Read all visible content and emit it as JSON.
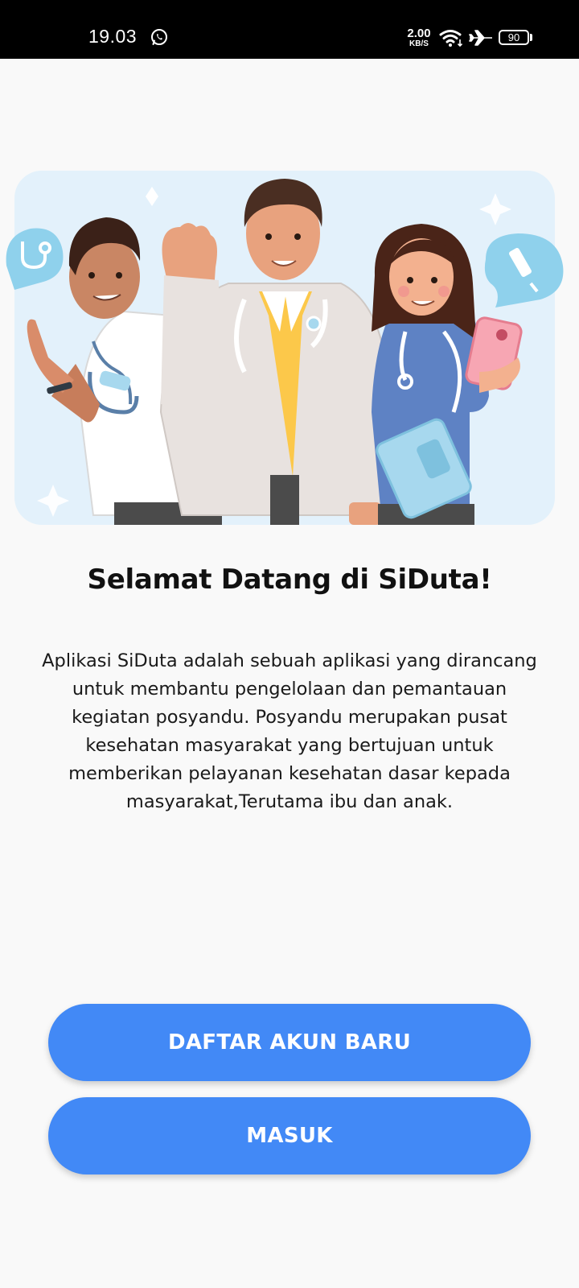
{
  "status_bar": {
    "time": "19.03",
    "net_speed_value": "2.00",
    "net_speed_unit": "KB/S",
    "battery_level": "90",
    "icons": [
      "whatsapp-icon",
      "wifi-icon",
      "airplane-mode-icon",
      "battery-icon"
    ]
  },
  "welcome": {
    "title": "Selamat Datang di SiDuta!",
    "description": "Aplikasi SiDuta adalah sebuah aplikasi yang dirancang untuk membantu pengelolaan dan pemantauan kegiatan posyandu. Posyandu merupakan pusat kesehatan masyarakat yang bertujuan untuk memberikan pelayanan kesehatan dasar kepada masyarakat,Terutama ibu dan anak."
  },
  "actions": {
    "register_label": "DAFTAR AKUN BARU",
    "login_label": "MASUK"
  },
  "colors": {
    "primary_button": "#4289f6",
    "background": "#f9f9f9",
    "status_bar": "#000000"
  }
}
